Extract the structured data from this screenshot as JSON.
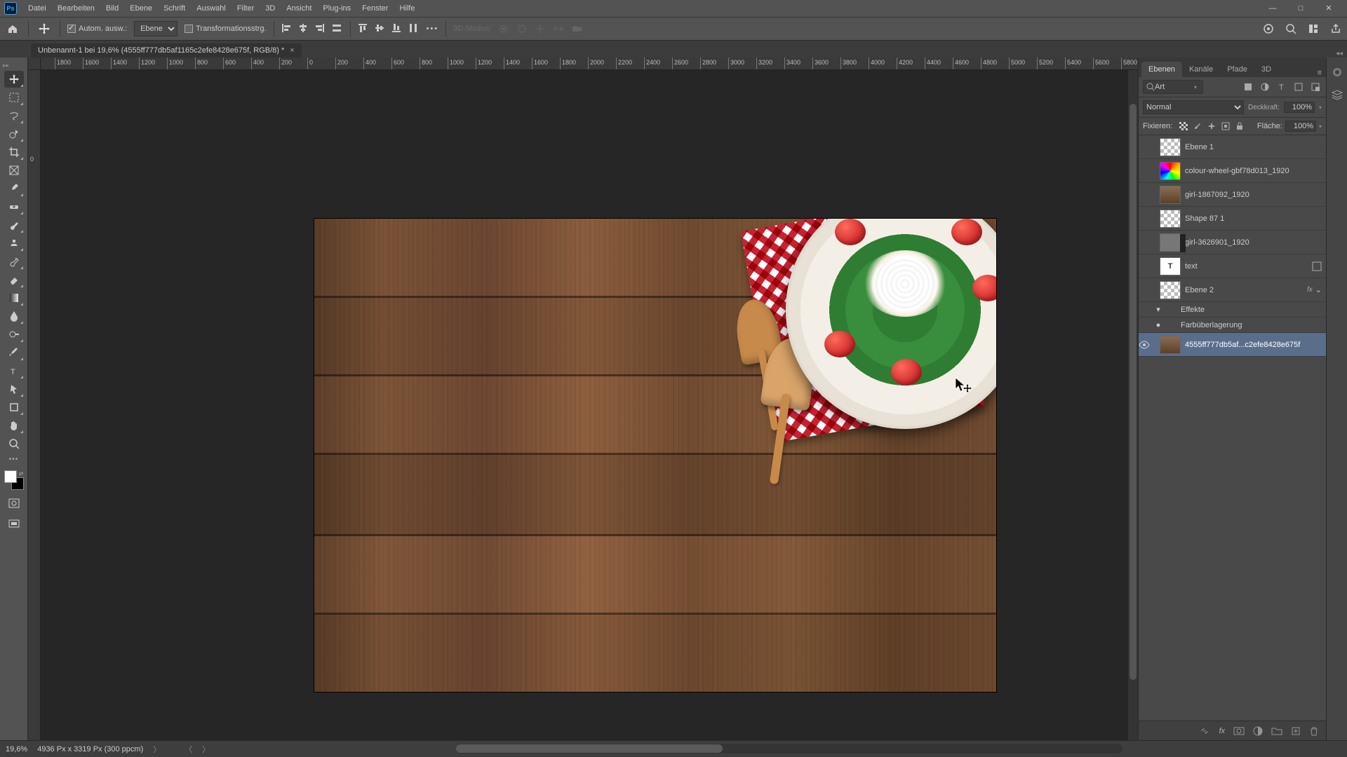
{
  "menubar": {
    "items": [
      "Datei",
      "Bearbeiten",
      "Bild",
      "Ebene",
      "Schrift",
      "Auswahl",
      "Filter",
      "3D",
      "Ansicht",
      "Plug-ins",
      "Fenster",
      "Hilfe"
    ]
  },
  "window_controls": {
    "min": "—",
    "max": "□",
    "close": "✕"
  },
  "optionsbar": {
    "auto_select_label": "Autom. ausw.:",
    "auto_select_target": "Ebene",
    "show_transform_label": "Transformationsstrg.",
    "mode3d_label": "3D-Modus:"
  },
  "document": {
    "tab_title": "Unbenannt-1 bei 19,6% (4555ff777db5af1165c2efe8428e675f, RGB/8) *"
  },
  "ruler": {
    "ticks": [
      "1800",
      "1600",
      "1400",
      "1200",
      "1000",
      "800",
      "600",
      "400",
      "200",
      "0",
      "200",
      "400",
      "600",
      "800",
      "1000",
      "1200",
      "1400",
      "1600",
      "1800",
      "2000",
      "2200",
      "2400",
      "2600",
      "2800",
      "3000",
      "3200",
      "3400",
      "3600",
      "3800",
      "4000",
      "4200",
      "4400",
      "4600",
      "4800",
      "5000",
      "5200",
      "5400",
      "5600",
      "5800"
    ],
    "vtick": "0"
  },
  "panels": {
    "tabs": [
      "Ebenen",
      "Kanäle",
      "Pfade",
      "3D"
    ],
    "search_label": "Art",
    "blend_mode": "Normal",
    "opacity_label": "Deckkraft:",
    "opacity_value": "100%",
    "lock_label": "Fixieren:",
    "fill_label": "Fläche:",
    "fill_value": "100%"
  },
  "layers": [
    {
      "visible": false,
      "thumb": "checker",
      "name": "Ebene 1"
    },
    {
      "visible": false,
      "thumb": "colorwheel",
      "name": "colour-wheel-gbf78d013_1920"
    },
    {
      "visible": false,
      "thumb": "photo",
      "name": "girl-1867092_1920"
    },
    {
      "visible": false,
      "thumb": "checker",
      "name": "Shape 87 1"
    },
    {
      "visible": false,
      "thumb": "mask",
      "name": "girl-3626901_1920"
    },
    {
      "visible": false,
      "thumb": "text",
      "name": "text",
      "fx": true
    },
    {
      "visible": false,
      "thumb": "checker",
      "name": "Ebene 2",
      "fx_label": "fx"
    },
    {
      "sub": true,
      "toggle": "▾",
      "name": "Effekte"
    },
    {
      "sub": true,
      "toggle": "●",
      "name": "Farbüberlagerung"
    },
    {
      "visible": true,
      "thumb": "photo",
      "name": "4555ff777db5af...c2efe8428e675f",
      "selected": true
    }
  ],
  "statusbar": {
    "zoom": "19,6%",
    "doc_info": "4936 Px x 3319 Px (300 ppcm)"
  }
}
